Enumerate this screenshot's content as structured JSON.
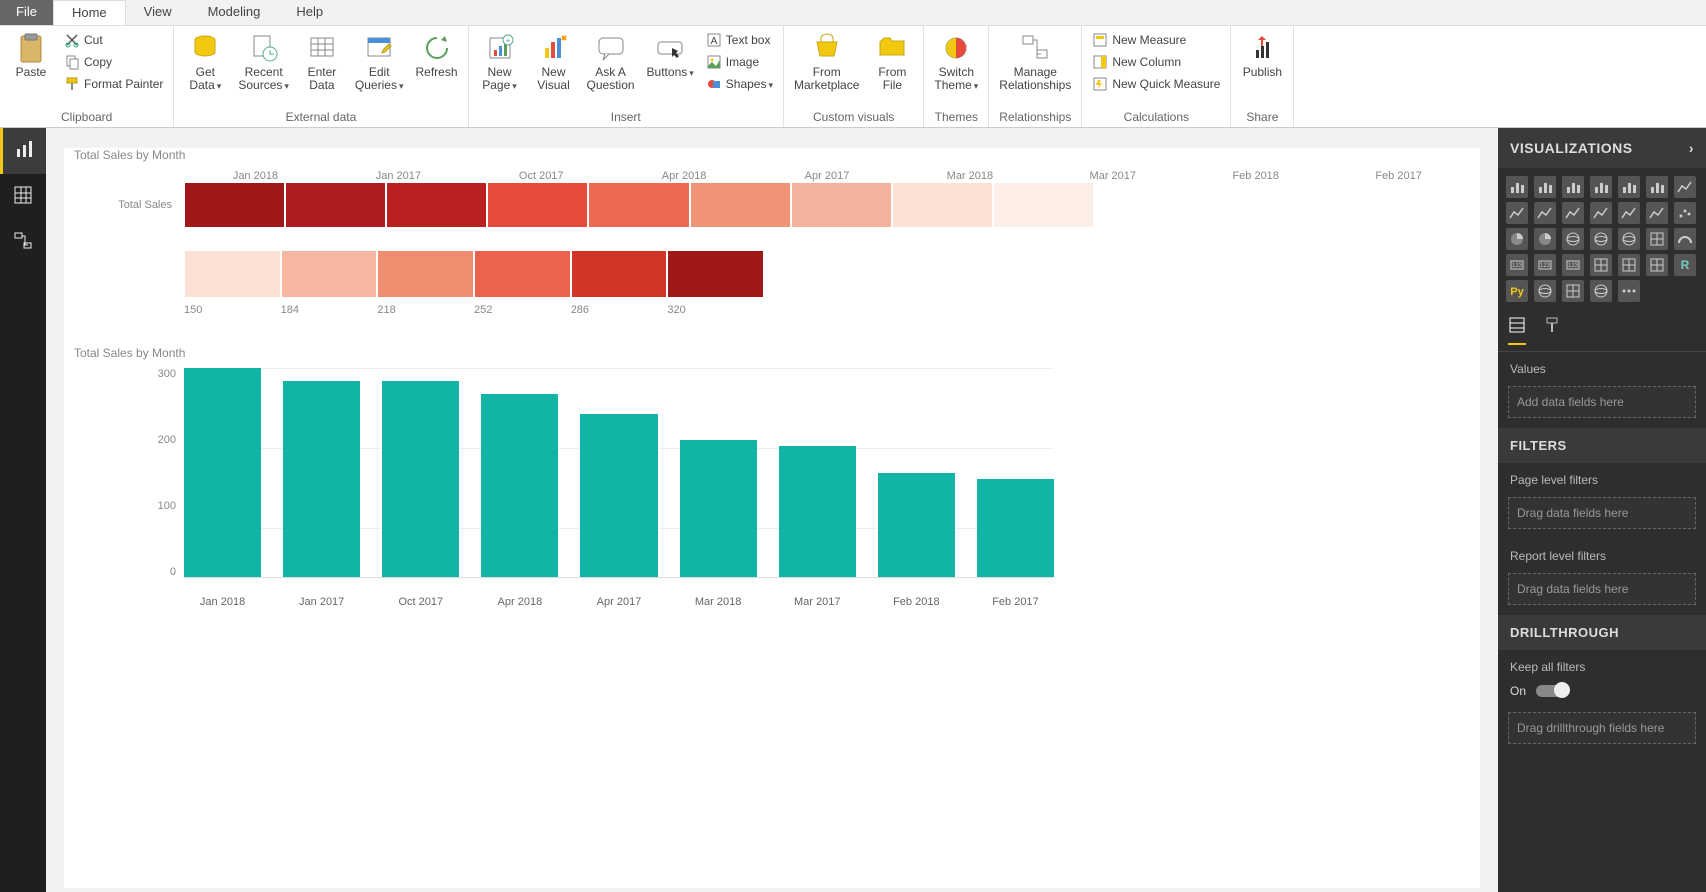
{
  "menubar": {
    "file": "File",
    "home": "Home",
    "view": "View",
    "modeling": "Modeling",
    "help": "Help"
  },
  "ribbon": {
    "clipboard": {
      "label": "Clipboard",
      "paste": "Paste",
      "cut": "Cut",
      "copy": "Copy",
      "format_painter": "Format Painter"
    },
    "external_data": {
      "label": "External data",
      "get_data": "Get\nData",
      "recent_sources": "Recent\nSources",
      "enter_data": "Enter\nData",
      "edit_queries": "Edit\nQueries",
      "refresh": "Refresh"
    },
    "insert_group": {
      "label": "Insert",
      "new_page": "New\nPage",
      "new_visual": "New\nVisual",
      "ask_question": "Ask A\nQuestion",
      "buttons": "Buttons",
      "text_box": "Text box",
      "image": "Image",
      "shapes": "Shapes"
    },
    "custom_visuals": {
      "label": "Custom visuals",
      "from_marketplace": "From\nMarketplace",
      "from_file": "From\nFile"
    },
    "themes": {
      "label": "Themes",
      "switch_theme": "Switch\nTheme"
    },
    "relationships": {
      "label": "Relationships",
      "manage": "Manage\nRelationships"
    },
    "calculations": {
      "label": "Calculations",
      "new_measure": "New Measure",
      "new_column": "New Column",
      "new_quick_measure": "New Quick Measure"
    },
    "share": {
      "label": "Share",
      "publish": "Publish"
    }
  },
  "chart_data": [
    {
      "type": "heatmap",
      "title": "Total Sales by Month",
      "row_label": "Total Sales",
      "categories": [
        "Jan 2018",
        "Jan 2017",
        "Oct 2017",
        "Apr 2018",
        "Apr 2017",
        "Mar 2018",
        "Mar 2017",
        "Feb 2018",
        "Feb 2017"
      ],
      "values": [
        320,
        300,
        300,
        280,
        250,
        210,
        200,
        160,
        150
      ],
      "colors": [
        "#a01919",
        "#ad1d1d",
        "#b92020",
        "#e74b3b",
        "#ec6a52",
        "#f09478",
        "#f5b39d",
        "#fbe1d6",
        "#fdeee8"
      ],
      "legend": {
        "ticks": [
          150,
          184,
          218,
          252,
          286,
          320
        ],
        "colors": [
          "#fbe1d6",
          "#f5b7a0",
          "#f08d71",
          "#eb634d",
          "#cf3627",
          "#a01919"
        ]
      }
    },
    {
      "type": "bar",
      "title": "Total Sales by Month",
      "categories": [
        "Jan 2018",
        "Jan 2017",
        "Oct 2017",
        "Apr 2018",
        "Apr 2017",
        "Mar 2018",
        "Mar 2017",
        "Feb 2018",
        "Feb 2017"
      ],
      "values": [
        320,
        300,
        300,
        280,
        250,
        210,
        200,
        160,
        150
      ],
      "ylim": [
        0,
        300
      ],
      "yticks": [
        300,
        200,
        100,
        0
      ],
      "ylabel": "",
      "xlabel": ""
    }
  ],
  "right_panel": {
    "visualizations": "VISUALIZATIONS",
    "values": "Values",
    "add_data": "Add data fields here",
    "filters": "FILTERS",
    "page_filters": "Page level filters",
    "drag_data": "Drag data fields here",
    "report_filters": "Report level filters",
    "drillthrough": "DRILLTHROUGH",
    "keep_all": "Keep all filters",
    "on": "On",
    "drag_drill": "Drag drillthrough fields here"
  }
}
